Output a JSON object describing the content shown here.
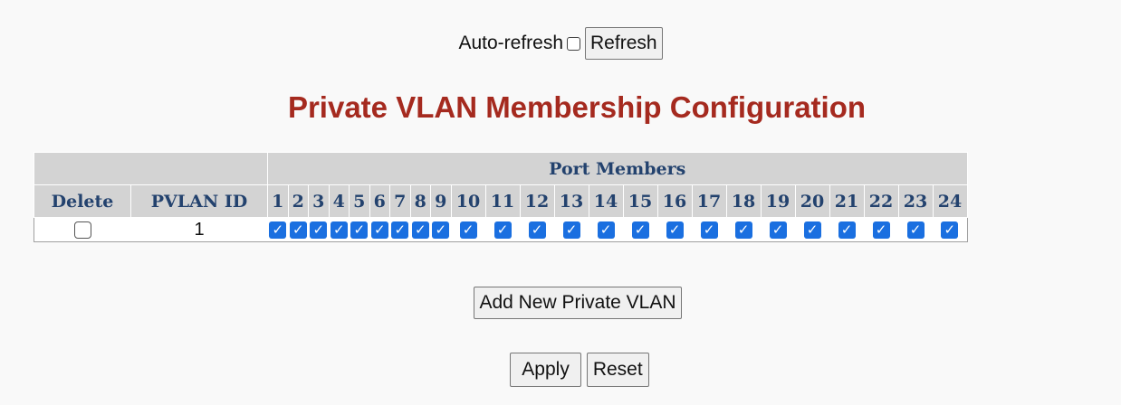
{
  "topbar": {
    "auto_refresh_label": "Auto-refresh",
    "refresh_label": "Refresh"
  },
  "title": "Private VLAN Membership Configuration",
  "table": {
    "group_header": "Port Members",
    "delete_header": "Delete",
    "pvlan_id_header": "PVLAN ID",
    "ports": [
      "1",
      "2",
      "3",
      "4",
      "5",
      "6",
      "7",
      "8",
      "9",
      "10",
      "11",
      "12",
      "13",
      "14",
      "15",
      "16",
      "17",
      "18",
      "19",
      "20",
      "21",
      "22",
      "23",
      "24"
    ],
    "rows": [
      {
        "delete": false,
        "pvlan_id": "1",
        "members": [
          true,
          true,
          true,
          true,
          true,
          true,
          true,
          true,
          true,
          true,
          true,
          true,
          true,
          true,
          true,
          true,
          true,
          true,
          true,
          true,
          true,
          true,
          true,
          true
        ]
      }
    ]
  },
  "buttons": {
    "add_new": "Add New Private VLAN",
    "apply": "Apply",
    "reset": "Reset"
  },
  "colors": {
    "title": "#a52a1f",
    "header_text": "#23426e",
    "header_bg": "#d3d3d3",
    "checkbox_checked": "#1a6fe0"
  }
}
